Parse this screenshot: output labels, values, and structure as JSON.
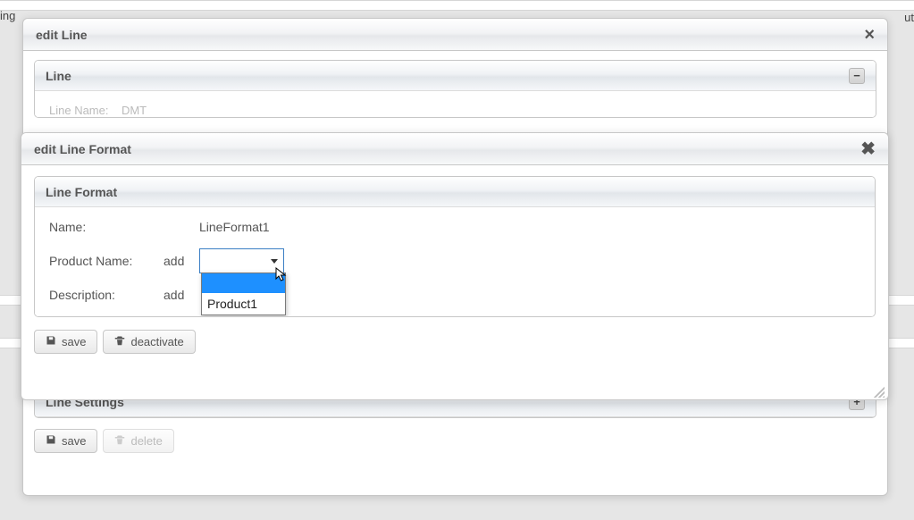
{
  "bg": {
    "left_text": "ing",
    "right_text": "ut"
  },
  "editLine": {
    "title": "edit Line",
    "panelLine": {
      "title": "Line",
      "badge": "−",
      "name_label": "Line Name:",
      "name_value": "DMT"
    },
    "panelSettings": {
      "title": "Line Settings",
      "badge": "+"
    },
    "buttons": {
      "save": "save",
      "delete": "delete"
    }
  },
  "editFormat": {
    "title": "edit Line Format",
    "panel": {
      "title": "Line Format",
      "rows": {
        "name_label": "Name:",
        "name_value": "LineFormat1",
        "product_label": "Product Name:",
        "product_add": "add",
        "description_label": "Description:",
        "description_add": "add"
      },
      "dropdown": {
        "options": [
          "",
          "Product1"
        ]
      }
    },
    "buttons": {
      "save": "save",
      "deactivate": "deactivate"
    }
  }
}
